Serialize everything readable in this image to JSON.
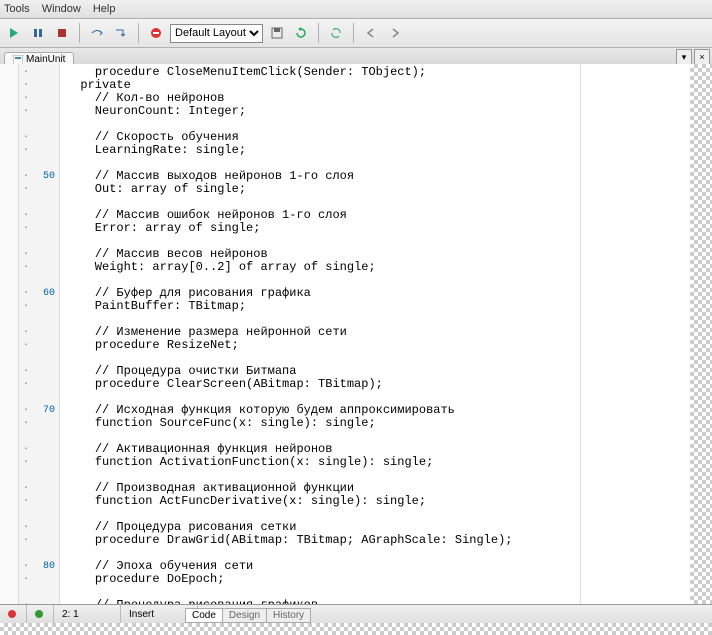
{
  "menu": {
    "tools": "Tools",
    "window": "Window",
    "help": "Help"
  },
  "toolbar": {
    "layout_options": [
      "Default Layout"
    ],
    "layout_selected": "Default Layout"
  },
  "tab": {
    "label": "MainUnit"
  },
  "bottom_tabs": {
    "code": "Code",
    "design": "Design",
    "history": "History"
  },
  "status": {
    "pos": "2: 1",
    "mode": "Insert"
  },
  "lines": [
    {
      "n": "",
      "d": 1,
      "h": "    <kw>procedure</kw> CloseMenuItemClick(Sender: TObject);"
    },
    {
      "n": "",
      "d": 1,
      "h": "  <kw>private</kw>"
    },
    {
      "n": "",
      "d": 1,
      "h": "    <cm>// Кол-во нейронов</cm>"
    },
    {
      "n": "",
      "d": 1,
      "h": "    NeuronCount: Integer;"
    },
    {
      "n": "",
      "d": 0,
      "h": ""
    },
    {
      "n": "",
      "d": 1,
      "h": "    <cm>// Скорость обучения</cm>"
    },
    {
      "n": "",
      "d": 1,
      "h": "    LearningRate: single;"
    },
    {
      "n": "",
      "d": 0,
      "h": ""
    },
    {
      "n": "50",
      "d": 1,
      "h": "    <cm>// Массив выходов нейронов 1-го слоя</cm>"
    },
    {
      "n": "",
      "d": 1,
      "h": "    Out: <kw>array of</kw> single;"
    },
    {
      "n": "",
      "d": 0,
      "h": ""
    },
    {
      "n": "",
      "d": 1,
      "h": "    <cm>// Массив ошибок нейронов 1-го слоя</cm>"
    },
    {
      "n": "",
      "d": 1,
      "h": "    Error: <kw>array of</kw> single;"
    },
    {
      "n": "",
      "d": 0,
      "h": ""
    },
    {
      "n": "",
      "d": 1,
      "h": "    <cm>// Массив весов нейронов</cm>"
    },
    {
      "n": "",
      "d": 1,
      "h": "    Weight: <kw>array</kw>[0..2] <kw>of array of</kw> single;"
    },
    {
      "n": "",
      "d": 0,
      "h": ""
    },
    {
      "n": "60",
      "d": 1,
      "h": "    <cm>// Буфер для рисования графика</cm>"
    },
    {
      "n": "",
      "d": 1,
      "h": "    PaintBuffer: TBitmap;"
    },
    {
      "n": "",
      "d": 0,
      "h": ""
    },
    {
      "n": "",
      "d": 1,
      "h": "    <cm>// Изменение размера нейронной сети</cm>"
    },
    {
      "n": "",
      "d": 1,
      "h": "    <kw>procedure</kw> ResizeNet;"
    },
    {
      "n": "",
      "d": 0,
      "h": ""
    },
    {
      "n": "",
      "d": 1,
      "h": "    <cm>// Процедура очистки Битмапа</cm>"
    },
    {
      "n": "",
      "d": 1,
      "h": "    <kw>procedure</kw> ClearScreen(ABitmap: TBitmap);"
    },
    {
      "n": "",
      "d": 0,
      "h": ""
    },
    {
      "n": "70",
      "d": 1,
      "h": "    <cm>// Исходная функция которую будем аппроксимировать</cm>"
    },
    {
      "n": "",
      "d": 1,
      "h": "    <kw>function</kw> SourceFunc(x: single): single;"
    },
    {
      "n": "",
      "d": 0,
      "h": ""
    },
    {
      "n": "",
      "d": 1,
      "h": "    <cm>// Активационная функция нейронов</cm>"
    },
    {
      "n": "",
      "d": 1,
      "h": "    <kw>function</kw> ActivationFunction(x: single): single;"
    },
    {
      "n": "",
      "d": 0,
      "h": ""
    },
    {
      "n": "",
      "d": 1,
      "h": "    <cm>// Производная активационной функции</cm>"
    },
    {
      "n": "",
      "d": 1,
      "h": "    <kw>function</kw> ActFuncDerivative(x: single): single;"
    },
    {
      "n": "",
      "d": 0,
      "h": ""
    },
    {
      "n": "",
      "d": 1,
      "h": "    <cm>// Процедура рисования сетки</cm>"
    },
    {
      "n": "",
      "d": 1,
      "h": "    <kw>procedure</kw> DrawGrid(ABitmap: TBitmap; AGraphScale: Single);"
    },
    {
      "n": "",
      "d": 0,
      "h": ""
    },
    {
      "n": "80",
      "d": 1,
      "h": "    <cm>// Эпоха обучения сети</cm>"
    },
    {
      "n": "",
      "d": 1,
      "h": "    <kw>procedure</kw> DoEpoch;"
    },
    {
      "n": "",
      "d": 0,
      "h": ""
    },
    {
      "n": "",
      "d": 1,
      "h": "    <cm>// Процедура рисования графиков</cm>"
    }
  ]
}
